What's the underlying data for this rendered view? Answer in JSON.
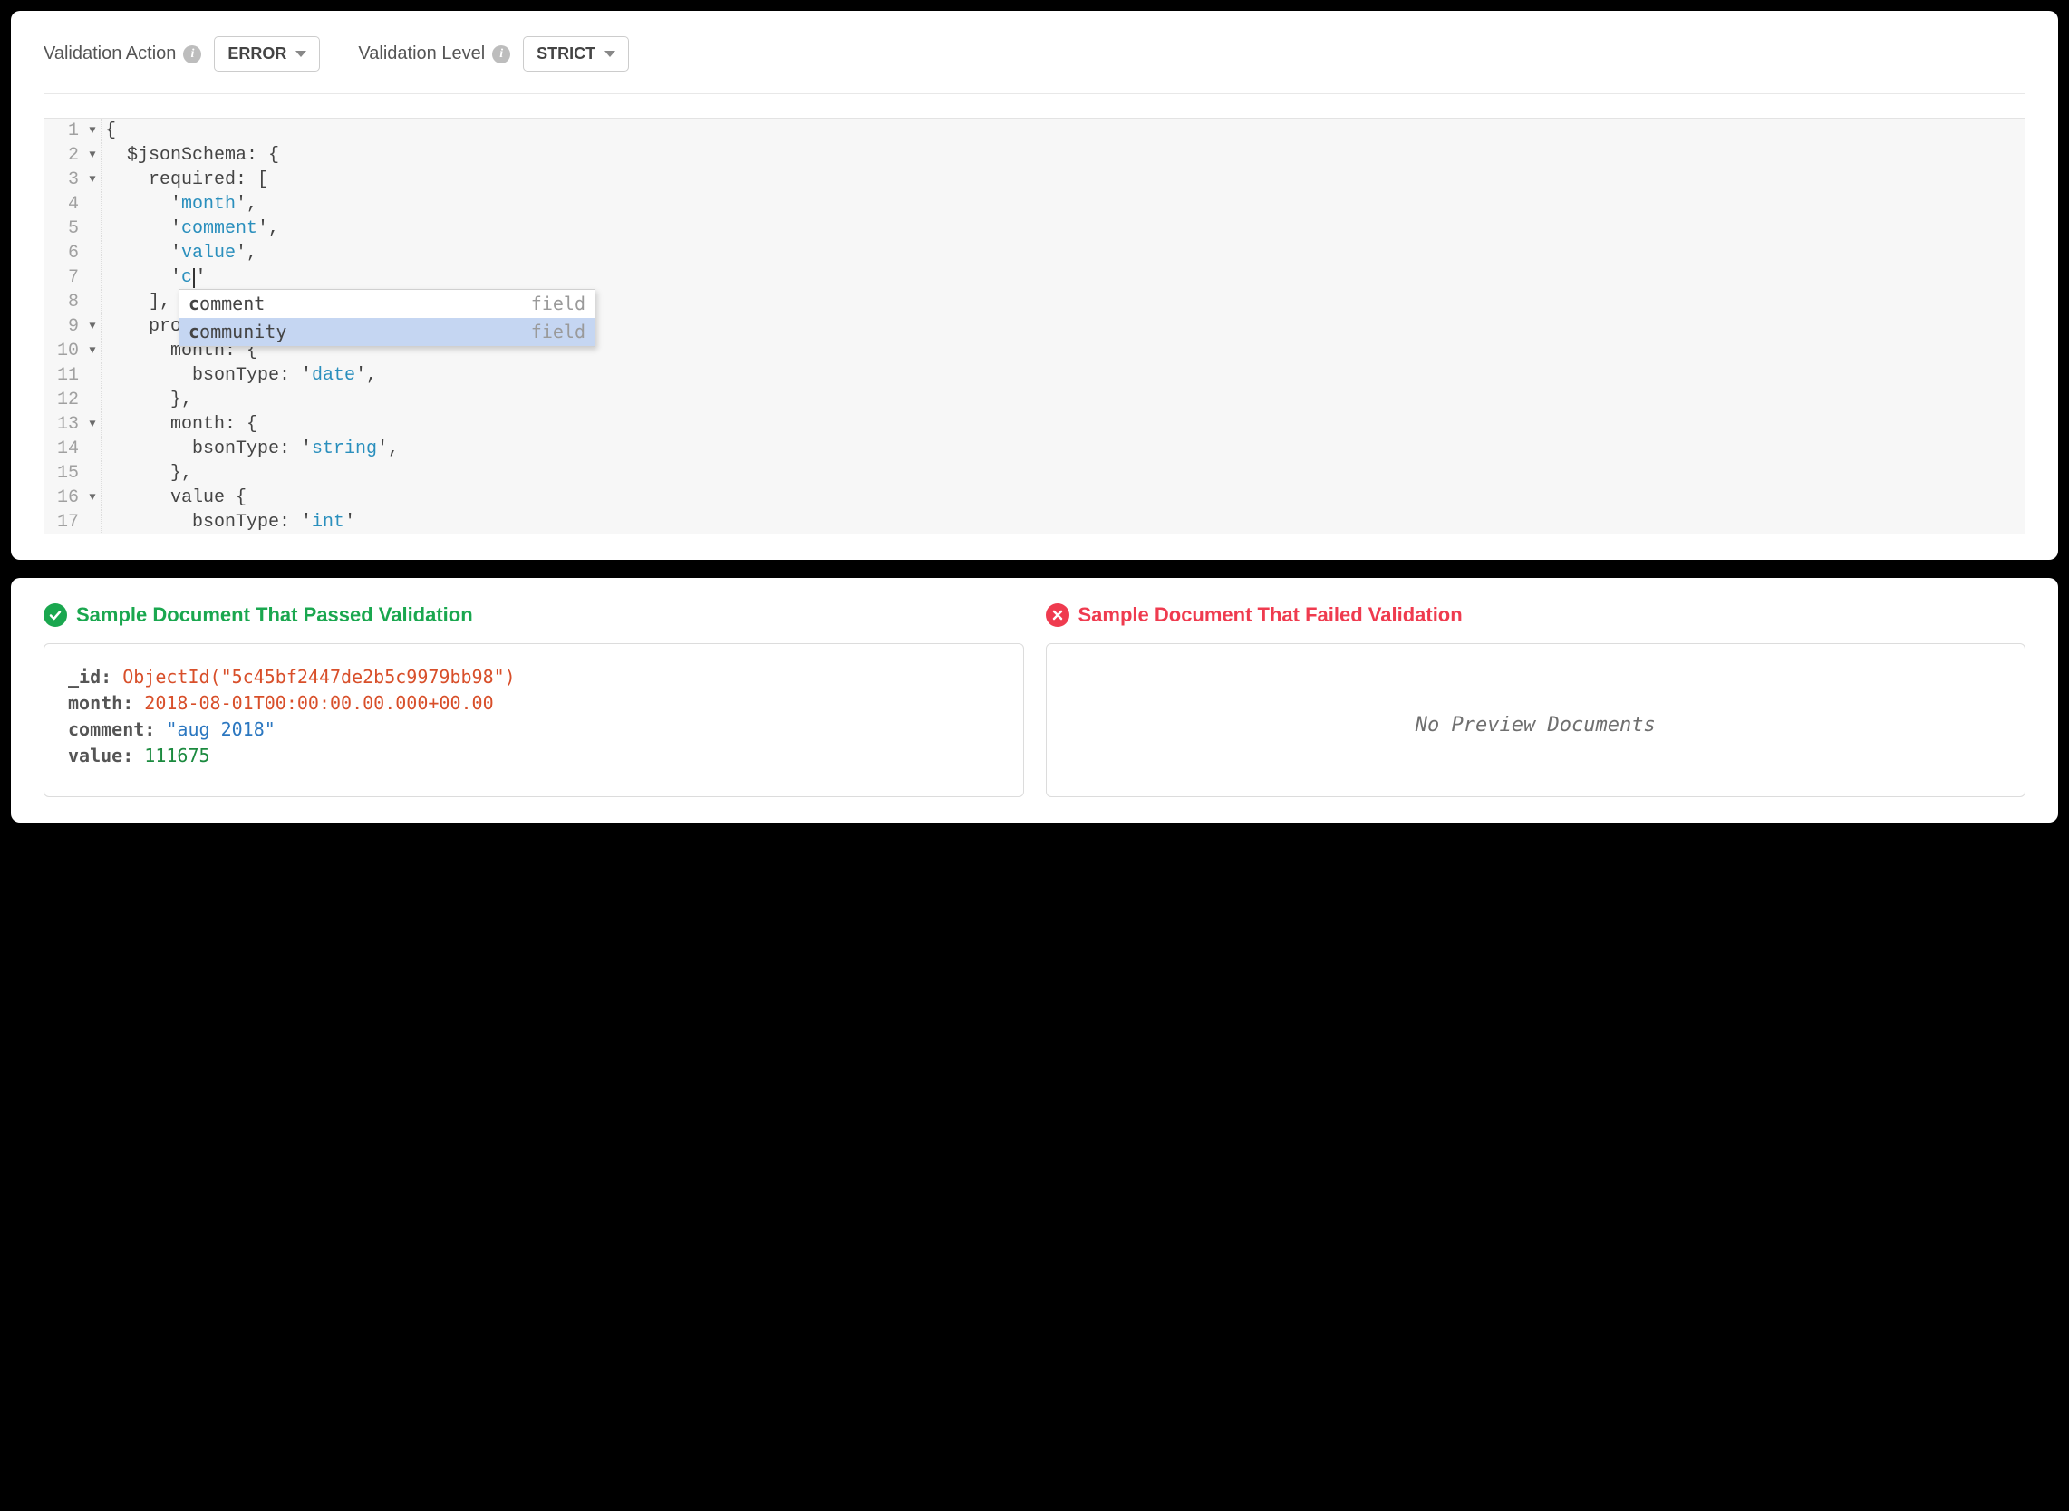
{
  "toolbar": {
    "validation_action_label": "Validation Action",
    "validation_action_value": "ERROR",
    "validation_level_label": "Validation Level",
    "validation_level_value": "STRICT"
  },
  "editor": {
    "lines": [
      {
        "n": 1,
        "fold": true,
        "indent": 0,
        "raw": "{"
      },
      {
        "n": 2,
        "fold": true,
        "indent": 1,
        "raw": "$jsonSchema: {"
      },
      {
        "n": 3,
        "fold": true,
        "indent": 2,
        "raw": "required: ["
      },
      {
        "n": 4,
        "fold": false,
        "indent": 3,
        "raw_pre": "'",
        "str": "month",
        "raw_post": "',"
      },
      {
        "n": 5,
        "fold": false,
        "indent": 3,
        "raw_pre": "'",
        "str": "comment",
        "raw_post": "',"
      },
      {
        "n": 6,
        "fold": false,
        "indent": 3,
        "raw_pre": "'",
        "str": "value",
        "raw_post": "',"
      },
      {
        "n": 7,
        "fold": false,
        "indent": 3,
        "raw_pre": "'",
        "str_partial": "c",
        "cursor": true,
        "raw_post": "'"
      },
      {
        "n": 8,
        "fold": false,
        "indent": 2,
        "raw": "],"
      },
      {
        "n": 9,
        "fold": true,
        "indent": 2,
        "raw": "pro"
      },
      {
        "n": 10,
        "fold": true,
        "indent": 3,
        "raw": "month: {"
      },
      {
        "n": 11,
        "fold": false,
        "indent": 4,
        "raw_pre": "bsonType: '",
        "str": "date",
        "raw_post": "',"
      },
      {
        "n": 12,
        "fold": false,
        "indent": 3,
        "raw": "},"
      },
      {
        "n": 13,
        "fold": true,
        "indent": 3,
        "raw": "month: {"
      },
      {
        "n": 14,
        "fold": false,
        "indent": 4,
        "raw_pre": "bsonType: '",
        "str": "string",
        "raw_post": "',"
      },
      {
        "n": 15,
        "fold": false,
        "indent": 3,
        "raw": "},"
      },
      {
        "n": 16,
        "fold": true,
        "indent": 3,
        "raw": "value {"
      },
      {
        "n": 17,
        "fold": false,
        "indent": 4,
        "raw_pre": "bsonType: '",
        "str": "int",
        "raw_post": "'"
      }
    ],
    "autocomplete": [
      {
        "match": "c",
        "rest": "omment",
        "meta": "field",
        "selected": false
      },
      {
        "match": "c",
        "rest": "ommunity",
        "meta": "field",
        "selected": true
      }
    ]
  },
  "results": {
    "pass_header": "Sample Document That Passed Validation",
    "fail_header": "Sample Document That Failed Validation",
    "passed_doc": {
      "_id": {
        "type": "objid",
        "display": "ObjectId(\"5c45bf2447de2b5c9979bb98\")"
      },
      "month": {
        "type": "date",
        "display": "2018-08-01T00:00:00.00.000+00.00"
      },
      "comment": {
        "type": "string",
        "display": "\"aug 2018\""
      },
      "value": {
        "type": "int",
        "display": "111675"
      }
    },
    "failed_empty_msg": "No Preview Documents"
  }
}
